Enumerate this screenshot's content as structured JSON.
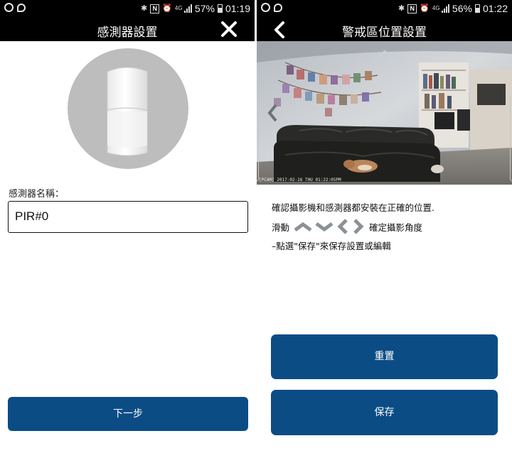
{
  "status_left": {
    "battery_pct": "57%",
    "time": "01:19",
    "network": "4G"
  },
  "status_right": {
    "battery_pct": "56%",
    "time": "01:22",
    "network": "4G"
  },
  "sensor_setup": {
    "title": "感測器設置",
    "close_icon": "close-icon",
    "name_label": "感測器名稱：",
    "name_value": "PIR#0",
    "next_label": "下一步"
  },
  "zone_setup": {
    "title": "警戒區位置設置",
    "back_icon": "chevron-left-icon",
    "camera_timestamp": "[PCAM] 2017-02-16 THU 01:22:05PM",
    "instruction_1": "確認攝影機和感測器都安裝在正確的位置.",
    "instruction_2_prefix": "滑動",
    "instruction_2_icons": [
      "chevron-up-icon",
      "chevron-down-icon",
      "chevron-left-icon",
      "chevron-right-icon"
    ],
    "instruction_2_suffix": "確定攝影角度",
    "instruction_3": "–點選\"保存\"來保存設置或編輯",
    "reset_label": "重置",
    "save_label": "保存"
  },
  "colors": {
    "primary_button": "#0b4c85",
    "title_bar": "#000000",
    "sensor_circle": "#bdbdbd"
  }
}
